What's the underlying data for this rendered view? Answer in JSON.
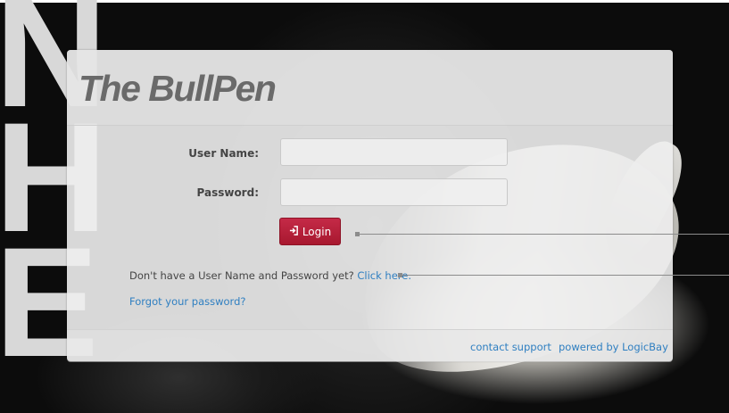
{
  "brand": {
    "title": "The BullPen"
  },
  "background": {
    "letters": [
      "N",
      "H",
      "E"
    ]
  },
  "form": {
    "username_label": "User Name:",
    "username_value": "",
    "password_label": "Password:",
    "password_value": "",
    "login_icon": "login-arrow-icon",
    "login_label": "Login"
  },
  "signup": {
    "prompt": "Don't have a User Name and Password yet?",
    "link": "Click here."
  },
  "forgot": {
    "link": "Forgot your password?"
  },
  "footer": {
    "contact": "contact support",
    "powered": "powered by LogicBay"
  },
  "colors": {
    "accent": "#b21f38",
    "link": "#2f7fc1",
    "brand_text": "#6a6a6a"
  }
}
